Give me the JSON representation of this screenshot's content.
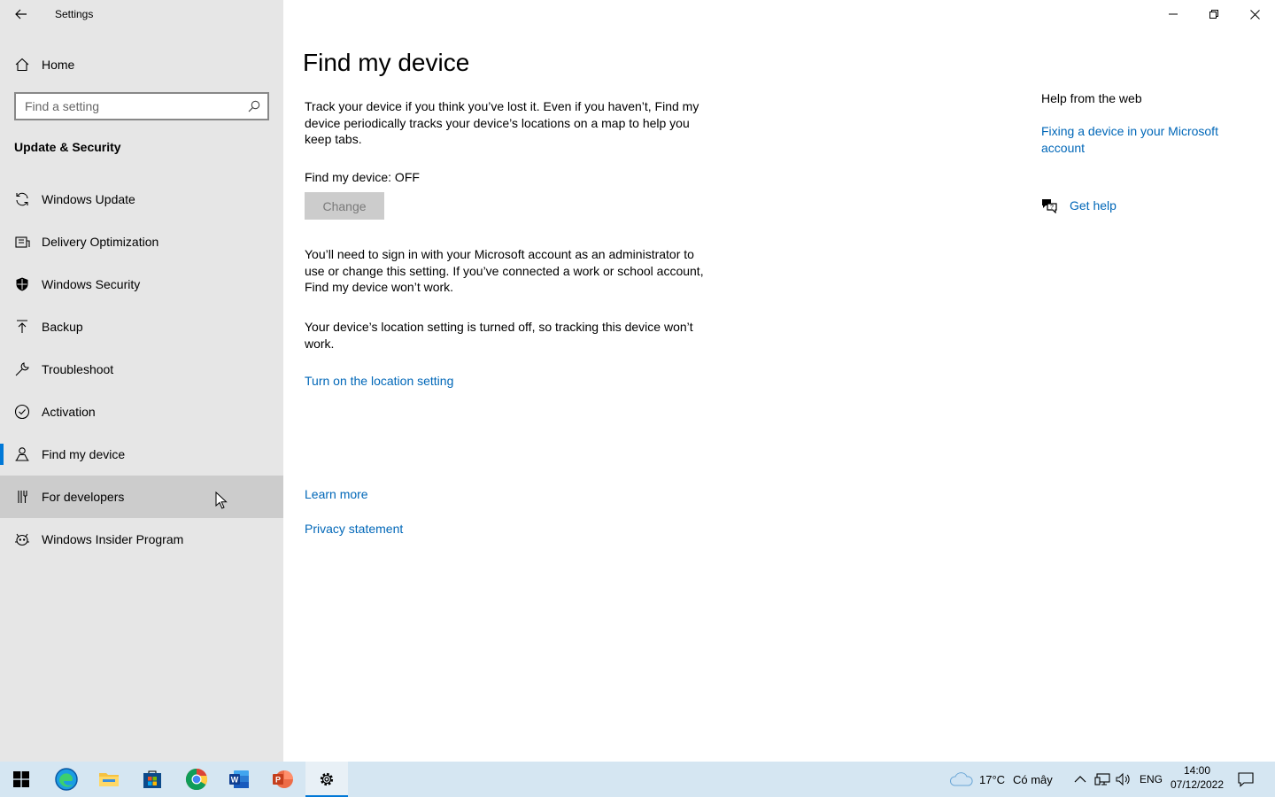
{
  "window": {
    "title": "Settings",
    "controls": [
      "minimize-icon",
      "restore-icon",
      "close-icon"
    ]
  },
  "sidebar": {
    "home_label": "Home",
    "search_placeholder": "Find a setting",
    "section_title": "Update & Security",
    "items": [
      {
        "label": "Windows Update",
        "icon": "refresh-icon"
      },
      {
        "label": "Delivery Optimization",
        "icon": "delivery-icon"
      },
      {
        "label": "Windows Security",
        "icon": "shield-icon"
      },
      {
        "label": "Backup",
        "icon": "backup-icon"
      },
      {
        "label": "Troubleshoot",
        "icon": "wrench-icon"
      },
      {
        "label": "Activation",
        "icon": "check-circle-icon"
      },
      {
        "label": "Find my device",
        "icon": "person-location-icon"
      },
      {
        "label": "For developers",
        "icon": "developer-icon"
      },
      {
        "label": "Windows Insider Program",
        "icon": "insider-icon"
      }
    ],
    "selected": "Find my device",
    "hovered": "For developers"
  },
  "main": {
    "title": "Find my device",
    "intro": "Track your device if you think you’ve lost it. Even if you haven’t, Find my device periodically tracks your device’s locations on a map to help you keep tabs.",
    "status": "Find my device: OFF",
    "change_button": "Change",
    "signin_note": "You’ll need to sign in with your Microsoft account as an administrator to use or change this setting. If you’ve connected a work or school account, Find my device won’t work.",
    "location_note": "Your device’s location setting is turned off, so tracking this device won’t work.",
    "location_link": "Turn on the location setting",
    "learn_more": "Learn more",
    "privacy": "Privacy statement"
  },
  "help": {
    "title": "Help from the web",
    "link": "Fixing a device in your Microsoft account",
    "get_help": "Get help"
  },
  "taskbar": {
    "apps": [
      "windows-start-icon",
      "edge-icon",
      "file-explorer-icon",
      "store-icon",
      "chrome-icon",
      "word-icon",
      "powerpoint-icon",
      "settings-icon"
    ],
    "weather_temp": "17°C",
    "weather_desc": "Có mây",
    "language": "ENG",
    "time": "14:00",
    "date": "07/12/2022"
  },
  "colors": {
    "accent": "#0078d7",
    "link": "#0067b8",
    "sidebar_bg": "#e6e6e6",
    "taskbar_bg": "#d5e6f2"
  }
}
